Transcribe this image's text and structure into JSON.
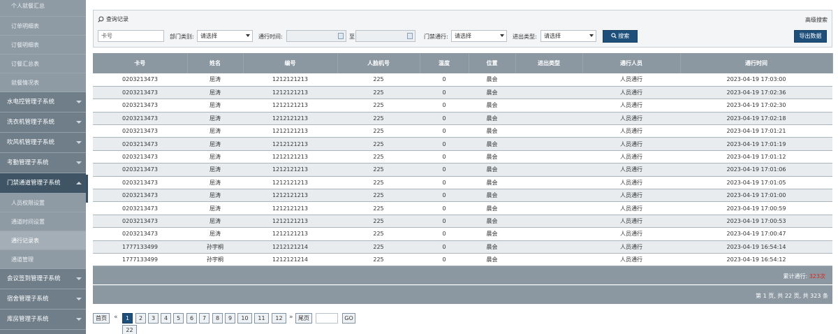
{
  "sidebar": {
    "top_items": [
      "个人就餐汇总",
      "订单明细表",
      "订餐明细表",
      "订餐汇总表",
      "就餐情况表"
    ],
    "groups_before": [
      "水电控管理子系统",
      "洗衣机管理子系统",
      "吹风机管理子系统",
      "考勤管理子系统"
    ],
    "open_group": "门禁通道管理子系统",
    "open_items": [
      "人员权限设置",
      "通道时间设置",
      "通行记录表",
      "通道管理"
    ],
    "groups_after": [
      "会议签到管理子系统",
      "宿舍管理子系统",
      "库房管理子系统",
      "信息发布管理子系统"
    ]
  },
  "search": {
    "title": "查询记录",
    "advanced": "高级搜索",
    "card_placeholder": "卡号",
    "dept_label": "部门类别:",
    "dept_value": "请选择",
    "time_label": "通行时间:",
    "to_label": "至",
    "gate_label": "门禁通行:",
    "gate_value": "请选择",
    "type_label": "进出类型:",
    "type_value": "请选择",
    "search_button": "搜索",
    "export_button": "导出数据"
  },
  "table": {
    "columns": [
      "卡号",
      "姓名",
      "编号",
      "人脸机号",
      "温度",
      "位置",
      "进出类型",
      "通行人员",
      "通行时间"
    ],
    "rows": [
      [
        "0203213473",
        "屈涛",
        "1212121213",
        "225",
        "0",
        "晨会",
        "",
        "人员通行",
        "2023-04-19 17:03:00"
      ],
      [
        "0203213473",
        "屈涛",
        "1212121213",
        "225",
        "0",
        "晨会",
        "",
        "人员通行",
        "2023-04-19 17:02:36"
      ],
      [
        "0203213473",
        "屈涛",
        "1212121213",
        "225",
        "0",
        "晨会",
        "",
        "人员通行",
        "2023-04-19 17:02:30"
      ],
      [
        "0203213473",
        "屈涛",
        "1212121213",
        "225",
        "0",
        "晨会",
        "",
        "人员通行",
        "2023-04-19 17:02:18"
      ],
      [
        "0203213473",
        "屈涛",
        "1212121213",
        "225",
        "0",
        "晨会",
        "",
        "人员通行",
        "2023-04-19 17:01:21"
      ],
      [
        "0203213473",
        "屈涛",
        "1212121213",
        "225",
        "0",
        "晨会",
        "",
        "人员通行",
        "2023-04-19 17:01:19"
      ],
      [
        "0203213473",
        "屈涛",
        "1212121213",
        "225",
        "0",
        "晨会",
        "",
        "人员通行",
        "2023-04-19 17:01:12"
      ],
      [
        "0203213473",
        "屈涛",
        "1212121213",
        "225",
        "0",
        "晨会",
        "",
        "人员通行",
        "2023-04-19 17:01:06"
      ],
      [
        "0203213473",
        "屈涛",
        "1212121213",
        "225",
        "0",
        "晨会",
        "",
        "人员通行",
        "2023-04-19 17:01:05"
      ],
      [
        "0203213473",
        "屈涛",
        "1212121213",
        "225",
        "0",
        "晨会",
        "",
        "人员通行",
        "2023-04-19 17:01:00"
      ],
      [
        "0203213473",
        "屈涛",
        "1212121213",
        "225",
        "0",
        "晨会",
        "",
        "人员通行",
        "2023-04-19 17:00:59"
      ],
      [
        "0203213473",
        "屈涛",
        "1212121213",
        "225",
        "0",
        "晨会",
        "",
        "人员通行",
        "2023-04-19 17:00:53"
      ],
      [
        "0203213473",
        "屈涛",
        "1212121213",
        "225",
        "0",
        "晨会",
        "",
        "人员通行",
        "2023-04-19 17:00:47"
      ],
      [
        "1777133499",
        "孙宇桐",
        "1212121214",
        "225",
        "0",
        "晨会",
        "",
        "人员通行",
        "2023-04-19 16:54:14"
      ],
      [
        "1777133499",
        "孙宇桐",
        "1212121214",
        "225",
        "0",
        "晨会",
        "",
        "人员通行",
        "2023-04-19 16:54:12"
      ]
    ]
  },
  "summary": {
    "label": "累计通行:",
    "count": "323次"
  },
  "page_info": "第 1 页, 共 22 页, 共 323 条",
  "pager": {
    "first": "首页",
    "prev_glyph": "«",
    "pages": [
      "1",
      "2",
      "3",
      "4",
      "5",
      "6",
      "7",
      "8",
      "9",
      "10",
      "11",
      "12"
    ],
    "next_glyph": "»",
    "last": "尾页",
    "go": "GO",
    "extra_page": "22"
  },
  "colors": {
    "primary": "#1e4e7a",
    "header_gray": "#8b98a2",
    "highlight_red": "#d9261c"
  }
}
